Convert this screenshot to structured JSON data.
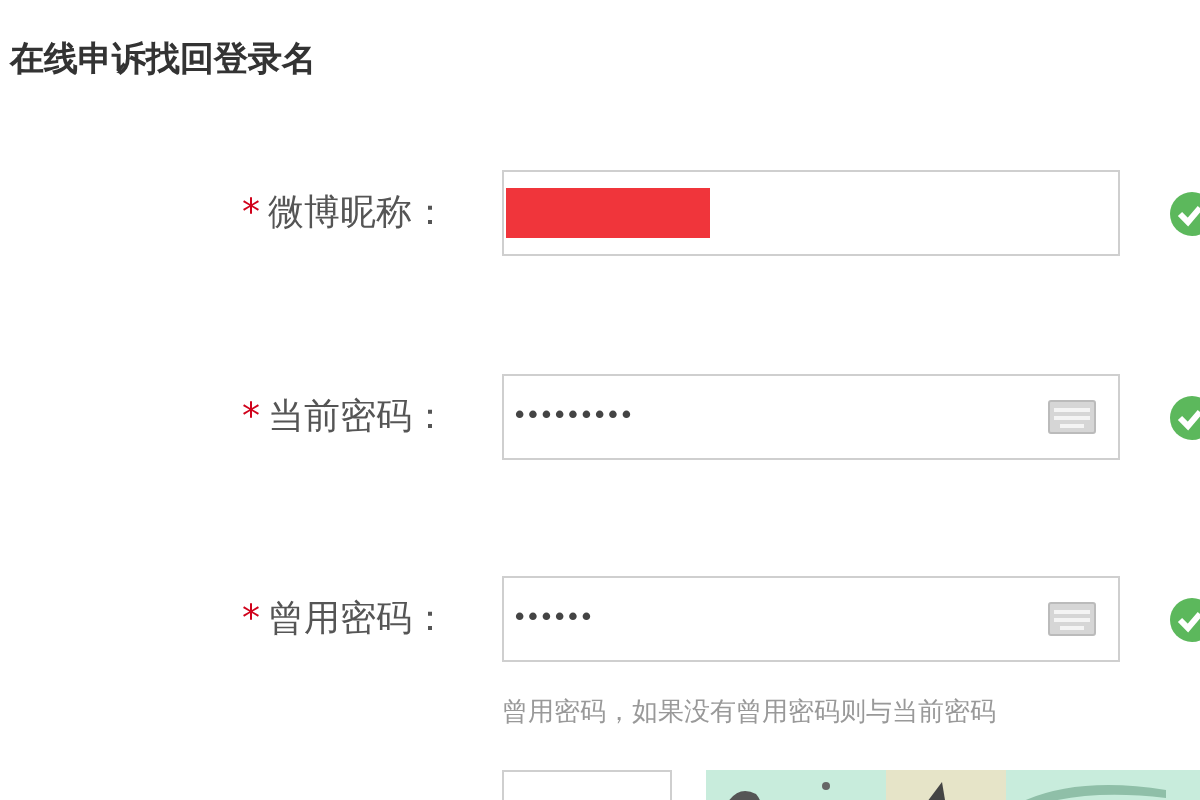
{
  "title": "在线申诉找回登录名",
  "fields": [
    {
      "label": "微博昵称：",
      "required_mark": "*",
      "kind": "text",
      "redacted": true,
      "valid": true
    },
    {
      "label": "当前密码：",
      "required_mark": "*",
      "kind": "password",
      "value": "•••••••••",
      "valid": true
    },
    {
      "label": "曾用密码：",
      "required_mark": "*",
      "kind": "password",
      "value": "••••••",
      "valid": true,
      "hint": "曾用密码，如果没有曾用密码则与当前密码"
    }
  ]
}
